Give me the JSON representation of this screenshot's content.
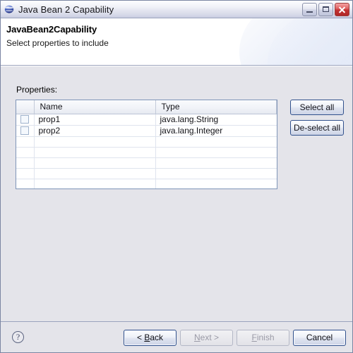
{
  "window": {
    "title": "Java Bean 2 Capability",
    "icon": "java-bean-globe-icon",
    "controls": {
      "minimize_label": "Minimize",
      "maximize_label": "Maximize",
      "close_label": "Close"
    }
  },
  "header": {
    "title": "JavaBean2Capability",
    "subtitle": "Select properties to include"
  },
  "body": {
    "properties_label": "Properties:",
    "table": {
      "columns": [
        "",
        "Name",
        "Type"
      ],
      "rows": [
        {
          "checked": false,
          "name": "prop1",
          "type": "java.lang.String"
        },
        {
          "checked": false,
          "name": "prop2",
          "type": "java.lang.Integer"
        }
      ],
      "empty_row_count": 5
    },
    "side_buttons": {
      "select_all": "Select all",
      "deselect_all": "De-select all"
    }
  },
  "footer": {
    "help_glyph": "?",
    "buttons": {
      "back": "< Back",
      "next": "Next >",
      "finish": "Finish",
      "cancel": "Cancel"
    },
    "disabled": [
      "next",
      "finish"
    ]
  },
  "colors": {
    "window_border": "#7b86a3",
    "body_background": "#e4e4ea",
    "header_background": "#ffffff",
    "table_border": "#7f95b8",
    "button_border": "#31518c",
    "close_button": "#c23232"
  }
}
